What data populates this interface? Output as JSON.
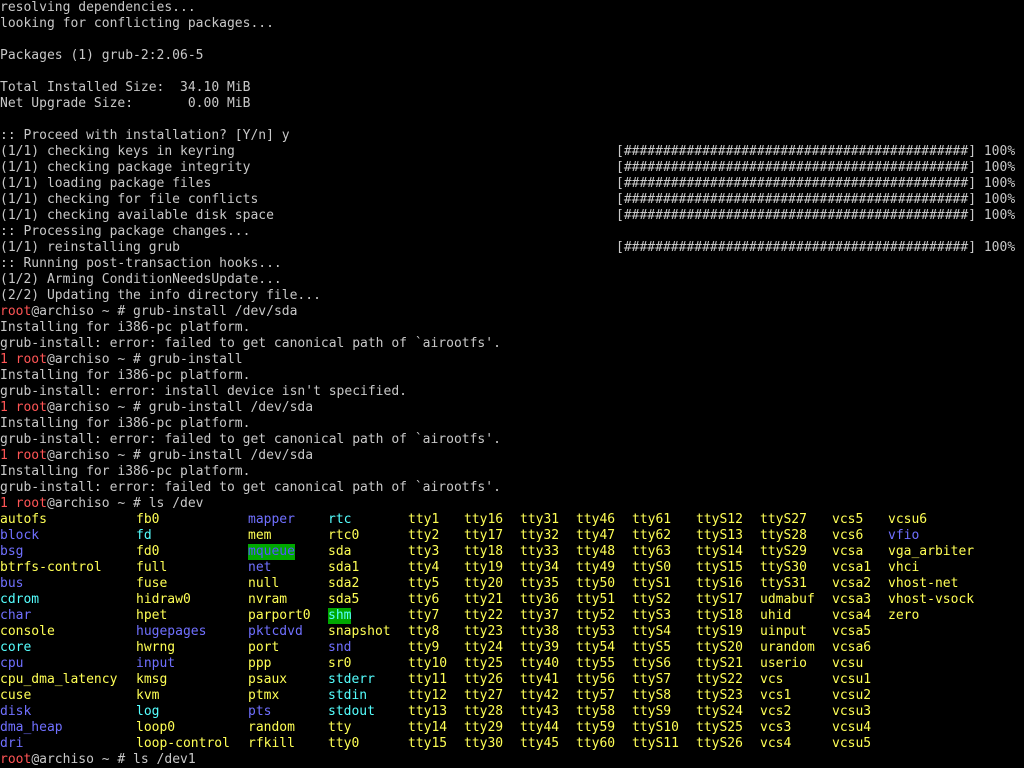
{
  "terminal": {
    "log_lines": [
      [
        {
          "t": "resolving dependencies...",
          "c": "def"
        }
      ],
      [
        {
          "t": "looking for conflicting packages...",
          "c": "def"
        }
      ],
      [
        {
          "t": "",
          "c": "def"
        }
      ],
      [
        {
          "t": "Packages (1) grub-2:2.06-5",
          "c": "def"
        }
      ],
      [
        {
          "t": "",
          "c": "def"
        }
      ],
      [
        {
          "t": "Total Installed Size:  34.10 MiB",
          "c": "def"
        }
      ],
      [
        {
          "t": "Net Upgrade Size:       0.00 MiB",
          "c": "def"
        }
      ],
      [
        {
          "t": "",
          "c": "def"
        }
      ],
      [
        {
          "t": ":: Proceed with installation? [Y/n] y",
          "c": "def"
        }
      ],
      [
        {
          "t": "(1/1) checking keys in keyring",
          "c": "def"
        }
      ],
      [
        {
          "t": "(1/1) checking package integrity",
          "c": "def"
        }
      ],
      [
        {
          "t": "(1/1) loading package files",
          "c": "def"
        }
      ],
      [
        {
          "t": "(1/1) checking for file conflicts",
          "c": "def"
        }
      ],
      [
        {
          "t": "(1/1) checking available disk space",
          "c": "def"
        }
      ],
      [
        {
          "t": ":: Processing package changes...",
          "c": "def"
        }
      ],
      [
        {
          "t": "(1/1) reinstalling grub",
          "c": "def"
        }
      ],
      [
        {
          "t": ":: Running post-transaction hooks...",
          "c": "def"
        }
      ],
      [
        {
          "t": "(1/2) Arming ConditionNeedsUpdate...",
          "c": "def"
        }
      ],
      [
        {
          "t": "(2/2) Updating the info directory file...",
          "c": "def"
        }
      ],
      [
        {
          "t": "root",
          "c": "red"
        },
        {
          "t": "@archiso ~ # grub-install /dev/sda",
          "c": "def"
        }
      ],
      [
        {
          "t": "Installing for i386-pc platform.",
          "c": "def"
        }
      ],
      [
        {
          "t": "grub-install: error: failed to get canonical path of `airootfs'.",
          "c": "def"
        }
      ],
      [
        {
          "t": "1 ",
          "c": "red"
        },
        {
          "t": "root",
          "c": "red"
        },
        {
          "t": "@archiso ~ # grub-install",
          "c": "def"
        }
      ],
      [
        {
          "t": "Installing for i386-pc platform.",
          "c": "def"
        }
      ],
      [
        {
          "t": "grub-install: error: install device isn't specified.",
          "c": "def"
        }
      ],
      [
        {
          "t": "1 ",
          "c": "red"
        },
        {
          "t": "root",
          "c": "red"
        },
        {
          "t": "@archiso ~ # grub-install /dev/sda",
          "c": "def"
        }
      ],
      [
        {
          "t": "Installing for i386-pc platform.",
          "c": "def"
        }
      ],
      [
        {
          "t": "grub-install: error: failed to get canonical path of `airootfs'.",
          "c": "def"
        }
      ],
      [
        {
          "t": "1 ",
          "c": "red"
        },
        {
          "t": "root",
          "c": "red"
        },
        {
          "t": "@archiso ~ # grub-install /dev/sda",
          "c": "def"
        }
      ],
      [
        {
          "t": "Installing for i386-pc platform.",
          "c": "def"
        }
      ],
      [
        {
          "t": "grub-install: error: failed to get canonical path of `airootfs'.",
          "c": "def"
        }
      ],
      [
        {
          "t": "1 ",
          "c": "red"
        },
        {
          "t": "root",
          "c": "red"
        },
        {
          "t": "@archiso ~ # ls /dev",
          "c": "def"
        }
      ]
    ],
    "progress_bars": [
      {
        "row": 9,
        "text": "[############################################] 100%",
        "percent": 100
      },
      {
        "row": 10,
        "text": "[############################################] 100%",
        "percent": 100
      },
      {
        "row": 11,
        "text": "[############################################] 100%",
        "percent": 100
      },
      {
        "row": 12,
        "text": "[############################################] 100%",
        "percent": 100
      },
      {
        "row": 13,
        "text": "[############################################] 100%",
        "percent": 100
      },
      {
        "row": 15,
        "text": "[############################################] 100%",
        "percent": 100
      }
    ],
    "ls_columns": [
      [
        [
          "autofs",
          "yellow"
        ],
        [
          "block",
          "blue"
        ],
        [
          "bsg",
          "blue"
        ],
        [
          "btrfs-control",
          "yellow"
        ],
        [
          "bus",
          "blue"
        ],
        [
          "cdrom",
          "cyan"
        ],
        [
          "char",
          "blue"
        ],
        [
          "console",
          "yellow"
        ],
        [
          "core",
          "cyan"
        ],
        [
          "cpu",
          "blue"
        ],
        [
          "cpu_dma_latency",
          "yellow"
        ],
        [
          "cuse",
          "yellow"
        ],
        [
          "disk",
          "blue"
        ],
        [
          "dma_heap",
          "blue"
        ],
        [
          "dri",
          "blue"
        ]
      ],
      [
        [
          "fb0",
          "yellow"
        ],
        [
          "fd",
          "cyan"
        ],
        [
          "fd0",
          "yellow"
        ],
        [
          "full",
          "yellow"
        ],
        [
          "fuse",
          "yellow"
        ],
        [
          "hidraw0",
          "yellow"
        ],
        [
          "hpet",
          "yellow"
        ],
        [
          "hugepages",
          "blue"
        ],
        [
          "hwrng",
          "yellow"
        ],
        [
          "input",
          "blue"
        ],
        [
          "kmsg",
          "yellow"
        ],
        [
          "kvm",
          "yellow"
        ],
        [
          "log",
          "cyan"
        ],
        [
          "loop0",
          "yellow"
        ],
        [
          "loop-control",
          "yellow"
        ]
      ],
      [
        [
          "mapper",
          "blue"
        ],
        [
          "mem",
          "yellow"
        ],
        [
          "mqueue",
          "greenbg"
        ],
        [
          "net",
          "blue"
        ],
        [
          "null",
          "yellow"
        ],
        [
          "nvram",
          "yellow"
        ],
        [
          "parport0",
          "yellow"
        ],
        [
          "pktcdvd",
          "blue"
        ],
        [
          "port",
          "yellow"
        ],
        [
          "ppp",
          "yellow"
        ],
        [
          "psaux",
          "yellow"
        ],
        [
          "ptmx",
          "yellow"
        ],
        [
          "pts",
          "blue"
        ],
        [
          "random",
          "yellow"
        ],
        [
          "rfkill",
          "yellow"
        ]
      ],
      [
        [
          "rtc",
          "cyan"
        ],
        [
          "rtc0",
          "yellow"
        ],
        [
          "sda",
          "yellow"
        ],
        [
          "sda1",
          "yellow"
        ],
        [
          "sda2",
          "yellow"
        ],
        [
          "sda5",
          "yellow"
        ],
        [
          "shm",
          "cyangreen"
        ],
        [
          "snapshot",
          "yellow"
        ],
        [
          "snd",
          "blue"
        ],
        [
          "sr0",
          "yellow"
        ],
        [
          "stderr",
          "cyan"
        ],
        [
          "stdin",
          "cyan"
        ],
        [
          "stdout",
          "cyan"
        ],
        [
          "tty",
          "yellow"
        ],
        [
          "tty0",
          "yellow"
        ]
      ],
      [
        [
          "tty1",
          "yellow"
        ],
        [
          "tty2",
          "yellow"
        ],
        [
          "tty3",
          "yellow"
        ],
        [
          "tty4",
          "yellow"
        ],
        [
          "tty5",
          "yellow"
        ],
        [
          "tty6",
          "yellow"
        ],
        [
          "tty7",
          "yellow"
        ],
        [
          "tty8",
          "yellow"
        ],
        [
          "tty9",
          "yellow"
        ],
        [
          "tty10",
          "yellow"
        ],
        [
          "tty11",
          "yellow"
        ],
        [
          "tty12",
          "yellow"
        ],
        [
          "tty13",
          "yellow"
        ],
        [
          "tty14",
          "yellow"
        ],
        [
          "tty15",
          "yellow"
        ]
      ],
      [
        [
          "tty16",
          "yellow"
        ],
        [
          "tty17",
          "yellow"
        ],
        [
          "tty18",
          "yellow"
        ],
        [
          "tty19",
          "yellow"
        ],
        [
          "tty20",
          "yellow"
        ],
        [
          "tty21",
          "yellow"
        ],
        [
          "tty22",
          "yellow"
        ],
        [
          "tty23",
          "yellow"
        ],
        [
          "tty24",
          "yellow"
        ],
        [
          "tty25",
          "yellow"
        ],
        [
          "tty26",
          "yellow"
        ],
        [
          "tty27",
          "yellow"
        ],
        [
          "tty28",
          "yellow"
        ],
        [
          "tty29",
          "yellow"
        ],
        [
          "tty30",
          "yellow"
        ]
      ],
      [
        [
          "tty31",
          "yellow"
        ],
        [
          "tty32",
          "yellow"
        ],
        [
          "tty33",
          "yellow"
        ],
        [
          "tty34",
          "yellow"
        ],
        [
          "tty35",
          "yellow"
        ],
        [
          "tty36",
          "yellow"
        ],
        [
          "tty37",
          "yellow"
        ],
        [
          "tty38",
          "yellow"
        ],
        [
          "tty39",
          "yellow"
        ],
        [
          "tty40",
          "yellow"
        ],
        [
          "tty41",
          "yellow"
        ],
        [
          "tty42",
          "yellow"
        ],
        [
          "tty43",
          "yellow"
        ],
        [
          "tty44",
          "yellow"
        ],
        [
          "tty45",
          "yellow"
        ]
      ],
      [
        [
          "tty46",
          "yellow"
        ],
        [
          "tty47",
          "yellow"
        ],
        [
          "tty48",
          "yellow"
        ],
        [
          "tty49",
          "yellow"
        ],
        [
          "tty50",
          "yellow"
        ],
        [
          "tty51",
          "yellow"
        ],
        [
          "tty52",
          "yellow"
        ],
        [
          "tty53",
          "yellow"
        ],
        [
          "tty54",
          "yellow"
        ],
        [
          "tty55",
          "yellow"
        ],
        [
          "tty56",
          "yellow"
        ],
        [
          "tty57",
          "yellow"
        ],
        [
          "tty58",
          "yellow"
        ],
        [
          "tty59",
          "yellow"
        ],
        [
          "tty60",
          "yellow"
        ]
      ],
      [
        [
          "tty61",
          "yellow"
        ],
        [
          "tty62",
          "yellow"
        ],
        [
          "tty63",
          "yellow"
        ],
        [
          "ttyS0",
          "yellow"
        ],
        [
          "ttyS1",
          "yellow"
        ],
        [
          "ttyS2",
          "yellow"
        ],
        [
          "ttyS3",
          "yellow"
        ],
        [
          "ttyS4",
          "yellow"
        ],
        [
          "ttyS5",
          "yellow"
        ],
        [
          "ttyS6",
          "yellow"
        ],
        [
          "ttyS7",
          "yellow"
        ],
        [
          "ttyS8",
          "yellow"
        ],
        [
          "ttyS9",
          "yellow"
        ],
        [
          "ttyS10",
          "yellow"
        ],
        [
          "ttyS11",
          "yellow"
        ]
      ],
      [
        [
          "ttyS12",
          "yellow"
        ],
        [
          "ttyS13",
          "yellow"
        ],
        [
          "ttyS14",
          "yellow"
        ],
        [
          "ttyS15",
          "yellow"
        ],
        [
          "ttyS16",
          "yellow"
        ],
        [
          "ttyS17",
          "yellow"
        ],
        [
          "ttyS18",
          "yellow"
        ],
        [
          "ttyS19",
          "yellow"
        ],
        [
          "ttyS20",
          "yellow"
        ],
        [
          "ttyS21",
          "yellow"
        ],
        [
          "ttyS22",
          "yellow"
        ],
        [
          "ttyS23",
          "yellow"
        ],
        [
          "ttyS24",
          "yellow"
        ],
        [
          "ttyS25",
          "yellow"
        ],
        [
          "ttyS26",
          "yellow"
        ]
      ],
      [
        [
          "ttyS27",
          "yellow"
        ],
        [
          "ttyS28",
          "yellow"
        ],
        [
          "ttyS29",
          "yellow"
        ],
        [
          "ttyS30",
          "yellow"
        ],
        [
          "ttyS31",
          "yellow"
        ],
        [
          "udmabuf",
          "yellow"
        ],
        [
          "uhid",
          "yellow"
        ],
        [
          "uinput",
          "yellow"
        ],
        [
          "urandom",
          "yellow"
        ],
        [
          "userio",
          "yellow"
        ],
        [
          "vcs",
          "yellow"
        ],
        [
          "vcs1",
          "yellow"
        ],
        [
          "vcs2",
          "yellow"
        ],
        [
          "vcs3",
          "yellow"
        ],
        [
          "vcs4",
          "yellow"
        ]
      ],
      [
        [
          "vcs5",
          "yellow"
        ],
        [
          "vcs6",
          "yellow"
        ],
        [
          "vcsa",
          "yellow"
        ],
        [
          "vcsa1",
          "yellow"
        ],
        [
          "vcsa2",
          "yellow"
        ],
        [
          "vcsa3",
          "yellow"
        ],
        [
          "vcsa4",
          "yellow"
        ],
        [
          "vcsa5",
          "yellow"
        ],
        [
          "vcsa6",
          "yellow"
        ],
        [
          "vcsu",
          "yellow"
        ],
        [
          "vcsu1",
          "yellow"
        ],
        [
          "vcsu2",
          "yellow"
        ],
        [
          "vcsu3",
          "yellow"
        ],
        [
          "vcsu4",
          "yellow"
        ],
        [
          "vcsu5",
          "yellow"
        ]
      ],
      [
        [
          "vcsu6",
          "yellow"
        ],
        [
          "vfio",
          "blue"
        ],
        [
          "vga_arbiter",
          "yellow"
        ],
        [
          "vhci",
          "yellow"
        ],
        [
          "vhost-net",
          "yellow"
        ],
        [
          "vhost-vsock",
          "yellow"
        ],
        [
          "zero",
          "yellow"
        ]
      ]
    ],
    "current_prompt": [
      {
        "t": "root",
        "c": "red"
      },
      {
        "t": "@archiso ~ # ls /dev1",
        "c": "def"
      }
    ],
    "colors": {
      "background": "#000000",
      "text": "#c8c8c8",
      "prompt_red": "#ff5555",
      "device_yellow": "#ffff55",
      "directory_blue": "#7070ff",
      "symlink_cyan": "#55ffff",
      "sticky_dir_bg": "#00a800"
    }
  }
}
